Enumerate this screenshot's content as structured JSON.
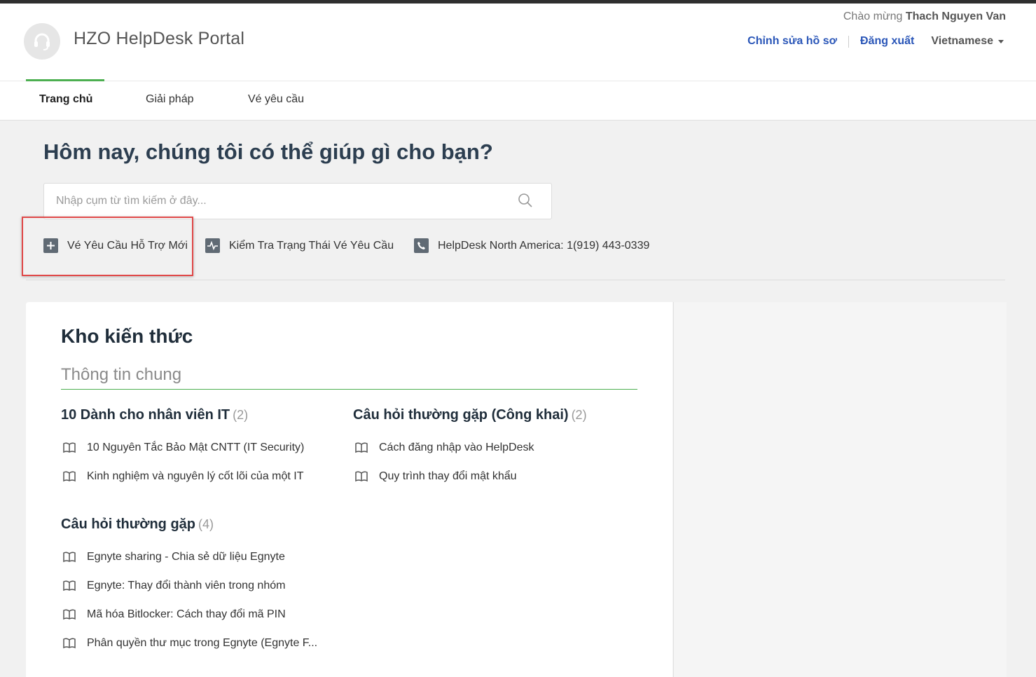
{
  "header": {
    "portal_name": "HZO HelpDesk Portal",
    "welcome_prefix": "Chào mừng",
    "welcome_user": "Thach Nguyen Van",
    "edit_profile": "Chỉnh sửa hồ sơ",
    "logout": "Đăng xuất",
    "language": "Vietnamese"
  },
  "tabs": [
    {
      "label": "Trang chủ",
      "active": true
    },
    {
      "label": "Giải pháp",
      "active": false
    },
    {
      "label": "Vé yêu cầu",
      "active": false
    }
  ],
  "hero": {
    "title": "Hôm nay, chúng tôi có thể giúp gì cho bạn?",
    "search_placeholder": "Nhập cụm từ tìm kiếm ở đây..."
  },
  "quick_links": {
    "new_ticket": "Vé Yêu Cầu Hỗ Trợ Mới",
    "check_status": "Kiểm Tra Trạng Thái Vé Yêu Cầu",
    "phone": "HelpDesk North America: 1(919) 443-0339"
  },
  "knowledge_base": {
    "title": "Kho kiến thức",
    "section": "Thông tin chung",
    "categories": [
      {
        "title": "10 Dành cho nhân viên IT",
        "count": "(2)",
        "articles": [
          "10 Nguyên Tắc Bảo Mật CNTT (IT Security)",
          "Kinh nghiệm và nguyên lý cốt lõi của một IT"
        ]
      },
      {
        "title": "Câu hỏi thường gặp (Công khai)",
        "count": "(2)",
        "articles": [
          "Cách đăng nhập vào HelpDesk",
          "Quy trình thay đổi mật khẩu"
        ]
      },
      {
        "title": "Câu hỏi thường gặp",
        "count": "(4)",
        "articles": [
          "Egnyte sharing - Chia sẻ dữ liệu Egnyte",
          "Egnyte: Thay đổi thành viên trong nhóm",
          "Mã hóa Bitlocker: Cách thay đổi mã PIN",
          "Phân quyền thư mục trong Egnyte (Egnyte F..."
        ]
      }
    ]
  },
  "colors": {
    "accent_green": "#4caf50",
    "link_blue": "#2a56b8",
    "highlight_red": "#e04848"
  },
  "icons": {
    "logo": "headset-icon",
    "search": "search-icon",
    "new_ticket": "plus-square-icon",
    "check_status": "activity-square-icon",
    "phone": "phone-square-icon",
    "article": "book-open-icon"
  }
}
